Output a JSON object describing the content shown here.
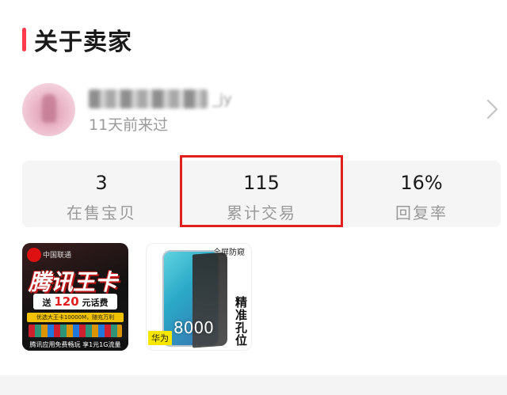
{
  "section": {
    "title": "关于卖家"
  },
  "seller": {
    "name_suffix": "_jy",
    "last_seen": "11天前来过"
  },
  "stats": [
    {
      "value": "3",
      "label": "在售宝贝"
    },
    {
      "value": "115",
      "label": "累计交易"
    },
    {
      "value": "16%",
      "label": "回复率"
    }
  ],
  "products": [
    {
      "brand": "中国联通",
      "title": "腾讯王卡",
      "ribbon_prefix": "送",
      "ribbon_amount": "120",
      "ribbon_suffix": "元话费",
      "band": "优选大王卡10000M，随充万利",
      "footer": "腾讯应用免费畅玩 享1元1G流量"
    },
    {
      "corner_text": "全屏防窥",
      "side_text": "精准孔位",
      "tag": "华为",
      "price": "8000"
    }
  ],
  "colors": {
    "accent": "#ff3a4a",
    "highlight_border": "#e0201c",
    "stats_bg": "#f5f5f5",
    "muted_text": "#999999"
  }
}
